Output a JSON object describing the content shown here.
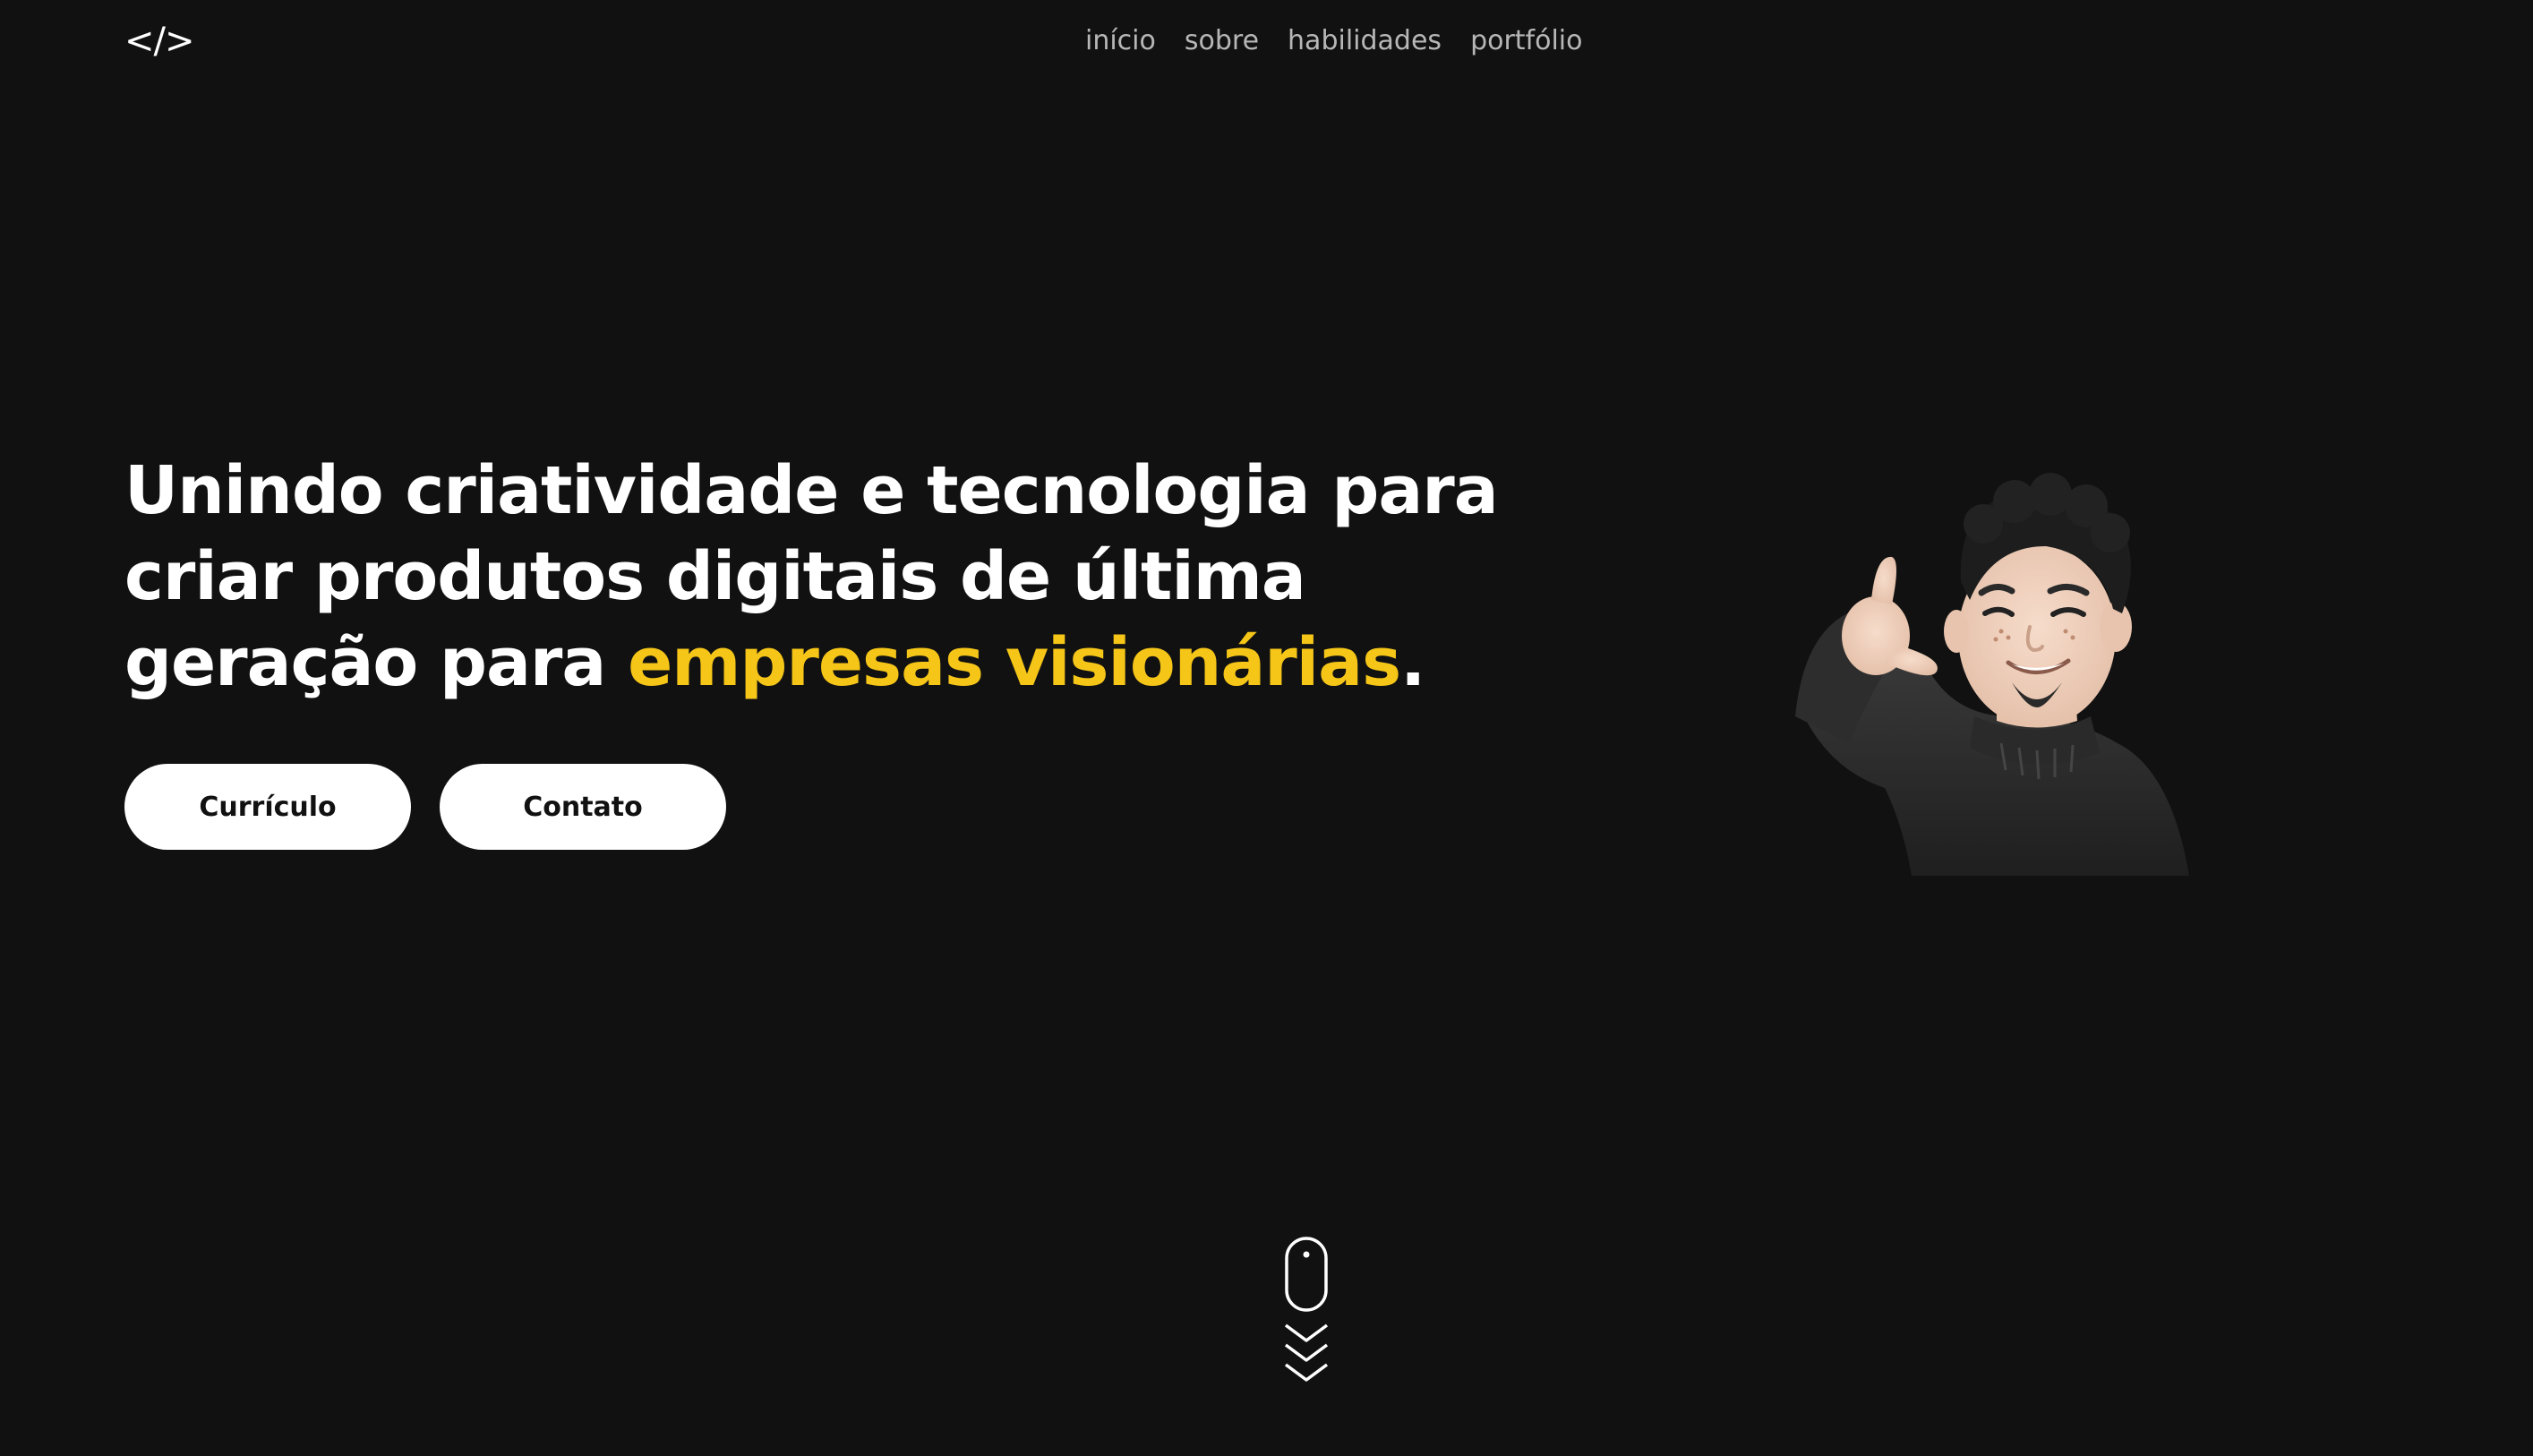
{
  "header": {
    "logo_text": "</>",
    "nav": [
      {
        "label": "início"
      },
      {
        "label": "sobre"
      },
      {
        "label": "habilidades"
      },
      {
        "label": "portfólio"
      }
    ]
  },
  "hero": {
    "headline_lead": "Unindo criatividade e tecnologia para criar produtos digitais de última geração para ",
    "headline_accent": "empresas visionárias",
    "headline_end": ".",
    "buttons": {
      "resume_label": "Currículo",
      "contact_label": "Contato"
    },
    "avatar_icon": "memoji-avatar"
  },
  "scroll_indicator": {
    "icon": "mouse-scroll-icon"
  },
  "colors": {
    "background": "#111111",
    "accent": "#f5c518",
    "nav_text": "#b7b7b7",
    "button_bg": "#ffffff"
  }
}
